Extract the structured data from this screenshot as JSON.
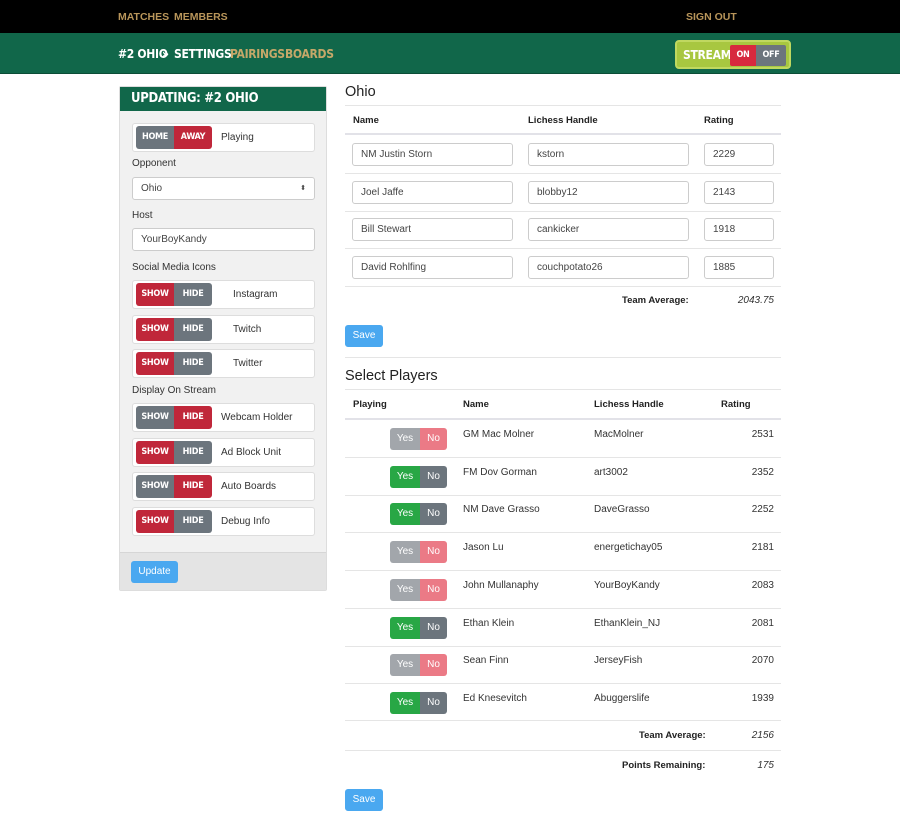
{
  "nav": {
    "matches": "MATCHES",
    "members": "MEMBERS",
    "sign_out": "SIGN OUT"
  },
  "breadcrumb": {
    "team": "#2 OHIO",
    "sep": "»",
    "settings": "SETTINGS",
    "pairings": "PAIRINGS",
    "boards": "BOARDS"
  },
  "stream": {
    "label": "STREAM",
    "on": "ON",
    "off": "OFF",
    "value": "ON"
  },
  "panel": {
    "title": "UPDATING: #2 OHIO",
    "home": "HOME",
    "away": "AWAY",
    "home_away_selected": "AWAY",
    "playing": "Playing",
    "opponent_label": "Opponent",
    "opponent_value": "Ohio",
    "host_label": "Host",
    "host_value": "YourBoyKandy",
    "social_label": "Social Media Icons",
    "social": [
      {
        "label": "Instagram",
        "selected": "SHOW"
      },
      {
        "label": "Twitch",
        "selected": "SHOW"
      },
      {
        "label": "Twitter",
        "selected": "SHOW"
      }
    ],
    "display_label": "Display On Stream",
    "display": [
      {
        "label": "Webcam Holder",
        "selected": "HIDE"
      },
      {
        "label": "Ad Block Unit",
        "selected": "SHOW"
      },
      {
        "label": "Auto Boards",
        "selected": "HIDE"
      },
      {
        "label": "Debug Info",
        "selected": "SHOW"
      }
    ],
    "show": "SHOW",
    "hide": "HIDE",
    "update": "Update"
  },
  "team": {
    "title": "Ohio",
    "headers": [
      "Name",
      "Lichess Handle",
      "Rating"
    ],
    "rows": [
      [
        "NM Justin Storn",
        "kstorn",
        "2229"
      ],
      [
        "Joel Jaffe",
        "blobby12",
        "2143"
      ],
      [
        "Bill Stewart",
        "cankicker",
        "1918"
      ],
      [
        "David Rohlfing",
        "couchpotato26",
        "1885"
      ]
    ],
    "avg_label": "Team Average:",
    "avg": "2043.75",
    "save": "Save"
  },
  "select": {
    "title": "Select Players",
    "headers": [
      "Playing",
      "Name",
      "Lichess Handle",
      "Rating"
    ],
    "yes": "Yes",
    "no": "No",
    "rows": [
      {
        "playing": false,
        "name": "GM Mac Molner",
        "handle": "MacMolner",
        "rating": "2531"
      },
      {
        "playing": true,
        "name": "FM Dov Gorman",
        "handle": "art3002",
        "rating": "2352"
      },
      {
        "playing": true,
        "name": "NM Dave Grasso",
        "handle": "DaveGrasso",
        "rating": "2252"
      },
      {
        "playing": false,
        "name": "Jason Lu",
        "handle": "energetichay05",
        "rating": "2181"
      },
      {
        "playing": false,
        "name": "John Mullanaphy",
        "handle": "YourBoyKandy",
        "rating": "2083"
      },
      {
        "playing": true,
        "name": "Ethan Klein",
        "handle": "EthanKlein_NJ",
        "rating": "2081"
      },
      {
        "playing": false,
        "name": "Sean Finn",
        "handle": "JerseyFish",
        "rating": "2070"
      },
      {
        "playing": true,
        "name": "Ed Knesevitch",
        "handle": "Abuggerslife",
        "rating": "1939"
      }
    ],
    "avg_label": "Team Average:",
    "avg": "2156",
    "points_label": "Points Remaining:",
    "points": "175",
    "save": "Save"
  },
  "colors": {
    "brand_green": "#11674a",
    "gold": "#b8955a",
    "selected_red": "#c0273a",
    "yes_green": "#28a745",
    "save_blue": "#4aa8f0"
  }
}
